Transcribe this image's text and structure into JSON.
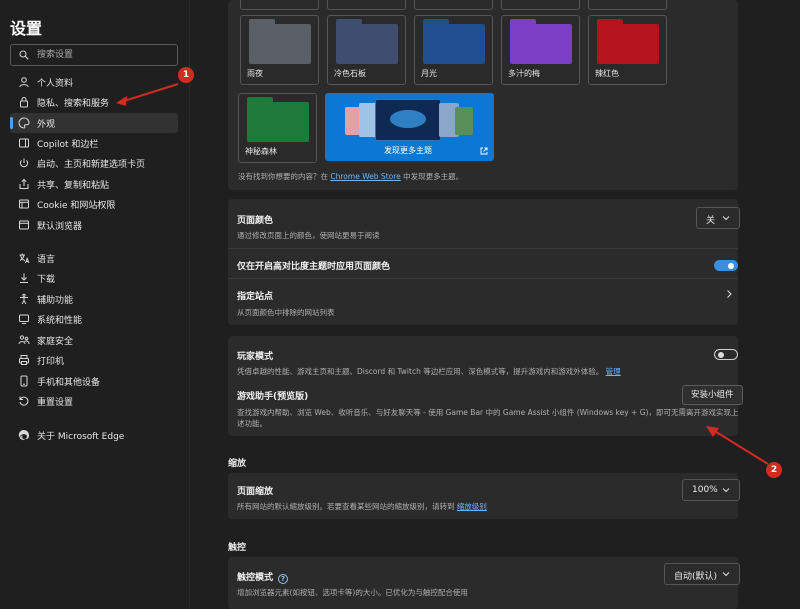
{
  "sidebar": {
    "title": "设置",
    "search_placeholder": "搜索设置",
    "items": [
      {
        "label": "个人资料",
        "icon": "person-icon"
      },
      {
        "label": "隐私、搜索和服务",
        "icon": "lock-icon"
      },
      {
        "label": "外观",
        "icon": "palette-icon"
      },
      {
        "label": "Copilot 和边栏",
        "icon": "sidebar-icon"
      },
      {
        "label": "启动、主页和新建选项卡页",
        "icon": "power-icon"
      },
      {
        "label": "共享、复制和粘贴",
        "icon": "share-icon"
      },
      {
        "label": "Cookie 和网站权限",
        "icon": "cookie-icon"
      },
      {
        "label": "默认浏览器",
        "icon": "browser-icon"
      },
      {
        "label": "语言",
        "icon": "language-icon"
      },
      {
        "label": "下载",
        "icon": "download-icon"
      },
      {
        "label": "辅助功能",
        "icon": "accessibility-icon"
      },
      {
        "label": "系统和性能",
        "icon": "monitor-icon"
      },
      {
        "label": "家庭安全",
        "icon": "family-icon"
      },
      {
        "label": "打印机",
        "icon": "printer-icon"
      },
      {
        "label": "手机和其他设备",
        "icon": "phone-icon"
      },
      {
        "label": "重置设置",
        "icon": "reset-icon"
      },
      {
        "label": "关于 Microsoft Edge",
        "icon": "edge-logo-icon"
      }
    ]
  },
  "annotations": [
    "1",
    "2"
  ],
  "themes": {
    "items": [
      {
        "label": "雨夜",
        "color": "#5b5f66"
      },
      {
        "label": "冷色石板",
        "color": "#3d4e6e"
      },
      {
        "label": "月光",
        "color": "#1f4f8f"
      },
      {
        "label": "多汁的梅",
        "color": "#7a3fc4"
      },
      {
        "label": "辣红色",
        "color": "#b5141c"
      },
      {
        "label": "神秘森林",
        "color": "#1e7a38"
      }
    ],
    "discover_label": "发现更多主题",
    "footer_prefix": "没有找到你想要的内容？在",
    "footer_link": "Chrome Web Store",
    "footer_suffix": "中发现更多主题。"
  },
  "page_color": {
    "title": "页面颜色",
    "desc": "通过修改页面上的颜色，使网站更易于阅读",
    "value": "关"
  },
  "high_contrast": {
    "title": "仅在开启高对比度主题时应用页面颜色",
    "on": true
  },
  "specified_sites": {
    "title": "指定站点",
    "desc": "从页面颜色中排除的网站列表"
  },
  "gamer_mode": {
    "title": "玩家模式",
    "desc": "凭借卓越的性能、游戏主页和主题、Discord 和 Twitch 等边栏应用、深色模式等，提升游戏内和游戏外体验。",
    "link": "管理",
    "on": false
  },
  "game_assist": {
    "title": "游戏助手(预览版)",
    "desc_line1": "查找游戏内帮助、浏览 Web、收听音乐、与好友聊天等 - 使用 Game Bar 中的 Game Assist 小组件 (Windows key + G)，即可无需离开游戏实现上",
    "desc_line2": "述功能。",
    "button": "安装小组件"
  },
  "zoom": {
    "section": "缩放",
    "title": "页面缩放",
    "desc_prefix": "所有网站的默认缩放级别。若要查看某些网站的缩放级别，请转到",
    "link": "缩放级别",
    "value": "100%"
  },
  "touch": {
    "section": "触控",
    "title": "触控模式",
    "desc": "增加浏览器元素(如按钮、选项卡等)的大小。已优化为与触控配合使用",
    "value": "自动(默认)"
  },
  "colors": {
    "accent": "#3b8ede",
    "annotation_red": "#d42a22"
  }
}
